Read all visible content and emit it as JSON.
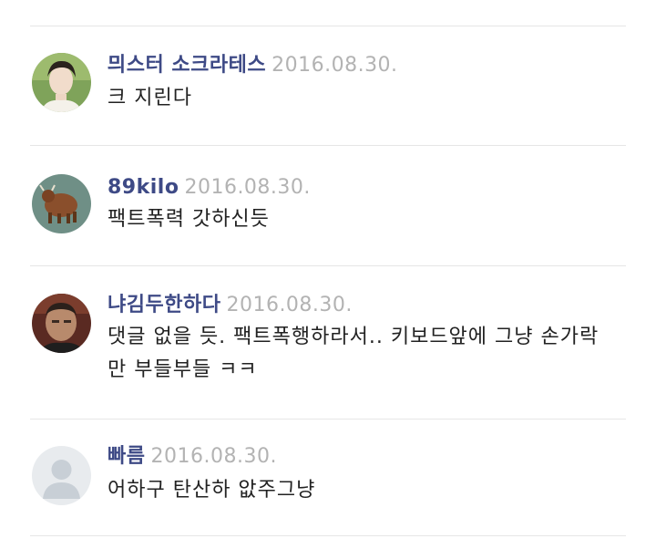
{
  "comments": [
    {
      "author": "믜스터 소크라테스",
      "date": "2016.08.30.",
      "text": "크 지린다",
      "avatar": "avatar-young-man-photo"
    },
    {
      "author": "89kilo",
      "date": "2016.08.30.",
      "text": "팩트폭력 갓하신듯",
      "avatar": "avatar-bull-drawing"
    },
    {
      "author": "냐김두한하다",
      "date": "2016.08.30.",
      "text": "댓글 없을 듯. 팩트폭행하라서.. 키보드앞에 그냥 손가락만 부들부들 ㅋㅋ",
      "avatar": "avatar-older-man-photo"
    },
    {
      "author": "빠름",
      "date": "2016.08.30.",
      "text": "어하구 탄산하 앖주그냥",
      "avatar": "avatar-default-user-silhouette"
    }
  ],
  "colors": {
    "author": "#3e4a86",
    "date": "#b3b3b3",
    "text": "#222222",
    "divider": "#e6e6e6"
  }
}
